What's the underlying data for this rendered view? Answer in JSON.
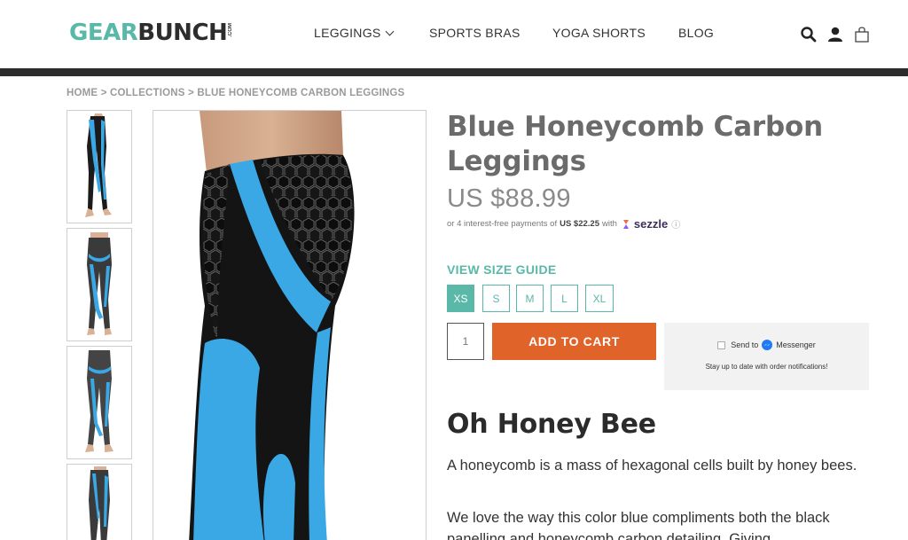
{
  "brand": {
    "part1": "GEAR",
    "part2": "BUNCH",
    "suffix": ".COM"
  },
  "nav": {
    "items": [
      {
        "label": "LEGGINGS",
        "has_dropdown": true
      },
      {
        "label": "SPORTS BRAS"
      },
      {
        "label": "YOGA SHORTS"
      },
      {
        "label": "BLOG"
      }
    ]
  },
  "header_icons": [
    "search-icon",
    "account-icon",
    "cart-icon"
  ],
  "breadcrumb": "HOME > COLLECTIONS > BLUE HONEYCOMB CARBON LEGGINGS",
  "product": {
    "title": "Blue Honeycomb Carbon Leggings",
    "price": "US $88.99",
    "sezzle": {
      "prefix": "or 4 interest-free payments of",
      "amount": "US $22.25",
      "with": "with",
      "brand": "sezzle",
      "info": "ⓘ"
    },
    "size_guide": "VIEW SIZE GUIDE",
    "sizes": [
      "XS",
      "S",
      "M",
      "L",
      "XL"
    ],
    "selected_size": "XS",
    "quantity": "1",
    "add_to_cart": "ADD TO CART"
  },
  "messenger": {
    "send_to": "Send to",
    "brand": "Messenger",
    "note": "Stay up to date with order notifications!"
  },
  "description": {
    "heading": "Oh Honey Bee",
    "p1": "A honeycomb is a mass of hexagonal cells built by honey bees.",
    "p2": "We love the way this color blue compliments both the black panelling and honeycomb carbon detailing. Giving"
  },
  "colors": {
    "accent": "#5ab8a8",
    "cart_button": "#e0642a",
    "legging_blue": "#3ba8e6",
    "header_bar": "#2d2d2d"
  }
}
